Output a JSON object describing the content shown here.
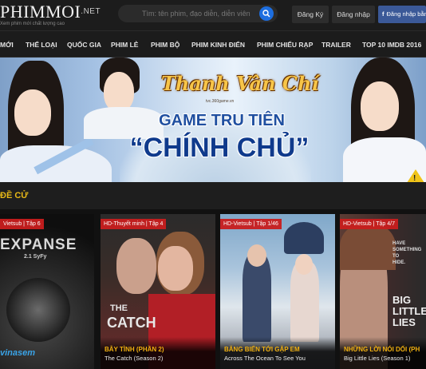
{
  "header": {
    "logo_text": "PHIMMOI",
    "logo_suffix": ".NET",
    "logo_tagline": "Xem phim mới chất lượng cao",
    "search_placeholder": "Tìm: tên phim, đạo diễn, diễn viên",
    "register_label": "Đăng Ký",
    "login_label": "Đăng nhập",
    "facebook_login_label": "Đăng nhập bằng",
    "icons": {
      "search": "search-icon",
      "facebook": "facebook-icon"
    },
    "colors": {
      "search_button": "#1d6ee0",
      "facebook": "#3b5998"
    }
  },
  "nav": {
    "items": [
      {
        "label": "MỚI"
      },
      {
        "label": "THỂ LOẠI"
      },
      {
        "label": "QUỐC GIA"
      },
      {
        "label": "PHIM LẺ"
      },
      {
        "label": "PHIM BỘ"
      },
      {
        "label": "PHIM KINH ĐIỂN"
      },
      {
        "label": "PHIM CHIẾU RẠP"
      },
      {
        "label": "TRAILER"
      },
      {
        "label": "TOP 10 IMDB 2016"
      }
    ]
  },
  "banner": {
    "game_logo": "Thanh Vân Chí",
    "game_logo_sub": "tvc.360game.vn",
    "slogan_line1": "GAME TRU TIÊN",
    "slogan_line2": "“CHÍNH CHỦ”",
    "warning_mark": "!"
  },
  "section": {
    "title": "ĐỀ CỬ",
    "accent_color": "#e7b817"
  },
  "cards": [
    {
      "badge": "Vietsub | Tập 6",
      "title": "",
      "subtitle": "",
      "poster_line1": "EXPANSE",
      "poster_line2": "2.1 SyFy",
      "poster_brand": "vinasem"
    },
    {
      "badge": "HD-Thuyết minh | Tập 4",
      "title": "BẪY TÌNH (PHẦN 2)",
      "subtitle": "The Catch (Season 2)",
      "poster_line1": "THE",
      "poster_line2": "CATCH"
    },
    {
      "badge": "HD-Vietsub | Tập 1/46",
      "title": "BĂNG BIỂN TỚI GẶP EM",
      "subtitle": "Across The Ocean To See You"
    },
    {
      "badge": "HD-Vietsub | Tập 4/7",
      "title": "NHỮNG LỜI NÓI DỐI (PH",
      "subtitle": "Big Little Lies (Season 1)",
      "poster_line1": "HAVE",
      "poster_line2": "SOMETHING",
      "poster_line3": "TO",
      "poster_line4": "HIDE.",
      "poster_big1": "BIG",
      "poster_big2": "LITTLE",
      "poster_big3": "LIES"
    }
  ]
}
